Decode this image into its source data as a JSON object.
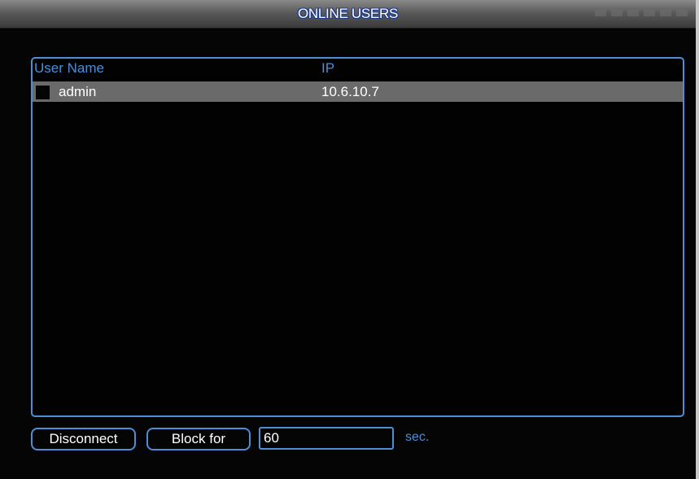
{
  "window": {
    "title": "ONLINE USERS"
  },
  "table": {
    "columns": [
      "User Name",
      "IP"
    ],
    "rows": [
      {
        "user_name": "admin",
        "ip": "10.6.10.7",
        "selected": true,
        "checked": false
      }
    ]
  },
  "actions": {
    "disconnect_label": "Disconnect",
    "block_label": "Block for",
    "block_seconds_value": "60",
    "unit_label": "sec."
  },
  "colors": {
    "accent": "#4a8fd8",
    "background": "#050505",
    "row_highlight": "#6a6a6a",
    "title_text_outline": "#1e3a8a"
  }
}
